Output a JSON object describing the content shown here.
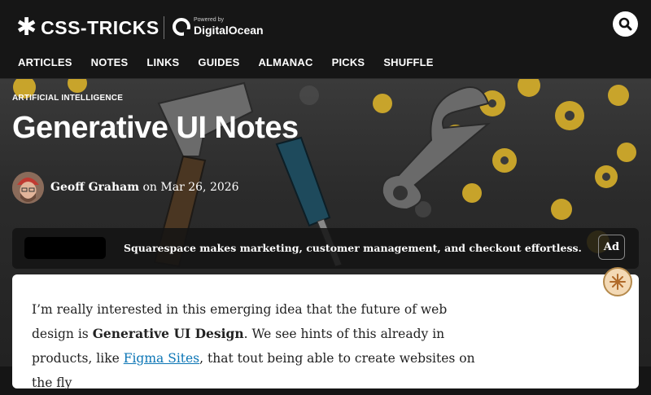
{
  "header": {
    "logo_star": "✱",
    "logo_text": "CSS-TRICKS",
    "sponsor_powered": "Powered by",
    "sponsor_name": "DigitalOcean",
    "nav": [
      "ARTICLES",
      "NOTES",
      "LINKS",
      "GUIDES",
      "ALMANAC",
      "PICKS",
      "SHUFFLE"
    ]
  },
  "article": {
    "category": "ARTIFICIAL INTELLIGENCE",
    "title": "Generative UI Notes",
    "author": "Geoff Graham",
    "byline_on": " on ",
    "date": "Mar 26, 2026",
    "intro_1": "I’m really interested in this emerging idea that the future of web design is ",
    "intro_bold": "Generative UI Design",
    "intro_2": ". We see hints of this already in products, like ",
    "intro_link": "Figma Sites",
    "intro_3": ", that tout being able to create websites on the fly"
  },
  "ad": {
    "text": "Squarespace makes marketing, customer management, and checkout effortless.",
    "badge": "Ad"
  },
  "colors": {
    "background": "#161616",
    "link": "#0b75b5",
    "screwdriver": "#1e4a5c"
  },
  "icons": [
    "search-icon",
    "digitalocean-icon",
    "star-icon",
    "sticker-icon"
  ]
}
